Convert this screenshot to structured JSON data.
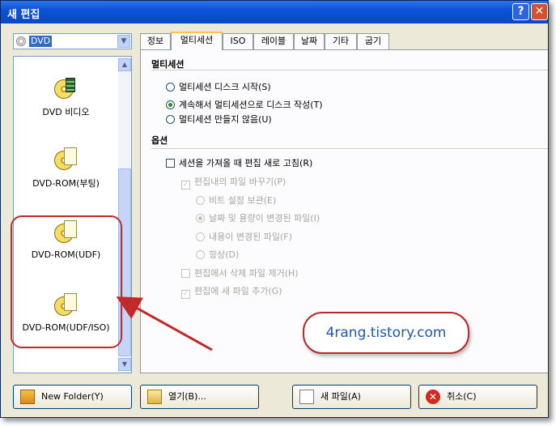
{
  "window": {
    "title": "새 편집",
    "help_label": "?",
    "close_label": "✕"
  },
  "dropdown": {
    "value": "DVD",
    "arrow_icon": "chevron-down-icon"
  },
  "list": {
    "items": [
      {
        "label": "DVD 비디오",
        "icon": "dvd-video-icon"
      },
      {
        "label": "DVD-ROM(부팅)",
        "icon": "dvd-rom-boot-icon"
      },
      {
        "label": "DVD-ROM(UDF)",
        "icon": "dvd-rom-udf-icon"
      },
      {
        "label": "DVD-ROM(UDF/ISO)",
        "icon": "dvd-rom-udf-iso-icon"
      }
    ]
  },
  "tabs": [
    "정보",
    "멀티세션",
    "ISO",
    "레이블",
    "날짜",
    "기타",
    "굽기"
  ],
  "active_tab": "멀티세션",
  "multisession": {
    "heading": "멀티세션",
    "options": [
      {
        "label": "멀티세션 디스크 시작(S)",
        "checked": false
      },
      {
        "label": "계속해서 멀티세션으로 디스크 작성(T)",
        "checked": true
      },
      {
        "label": "멀티세션 만들지 않음(U)",
        "checked": false
      }
    ]
  },
  "options_section": {
    "heading": "옵션",
    "import_session": "세션을 가져올 때 편집 새로 고침(R)",
    "replace_files": "편집내의 파일 바꾸기(P)",
    "replace_sub": [
      {
        "label": "비트 설정 보관(E)",
        "checked": false
      },
      {
        "label": "날짜 및 용량이 변경된 파일(I)",
        "checked": true
      },
      {
        "label": "내용이 변경된 파일(F)",
        "checked": false
      },
      {
        "label": "항상(D)",
        "checked": false
      }
    ],
    "remove_deleted": "편집에서 삭제 파일 제거(H)",
    "add_new": "편집에 새 파일 추가(G)"
  },
  "buttons": {
    "new_folder": "New Folder(Y)",
    "open": "열기(B)...",
    "new_file": "새 파일(A)",
    "cancel": "취소(C)"
  },
  "watermark": "4rang.tistory.com",
  "colors": {
    "title_bar": "#0a53d8",
    "highlight": "#c22a2a",
    "watermark_text": "#2055b8"
  }
}
